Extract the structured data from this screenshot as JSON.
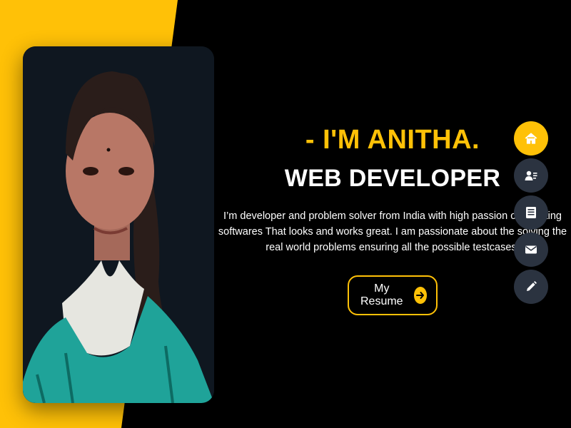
{
  "hero": {
    "greeting": "- I'M ANITHA.",
    "role": "WEB DEVELOPER",
    "description": "I’m developer and problem solver from India with high passion on creating softwares That looks and works great. I am passionate about the solving the real world problems ensuring all the possible testcases.",
    "resume_label": "My Resume"
  },
  "side_nav": {
    "items": [
      {
        "icon": "home-icon",
        "active": true
      },
      {
        "icon": "contact-card-icon",
        "active": false
      },
      {
        "icon": "newspaper-icon",
        "active": false
      },
      {
        "icon": "envelope-icon",
        "active": false
      },
      {
        "icon": "pencil-icon",
        "active": false
      }
    ]
  },
  "colors": {
    "accent": "#ffc107",
    "background": "#000000",
    "nav_inactive": "#2b3340",
    "photo_background": "#0f1720"
  }
}
